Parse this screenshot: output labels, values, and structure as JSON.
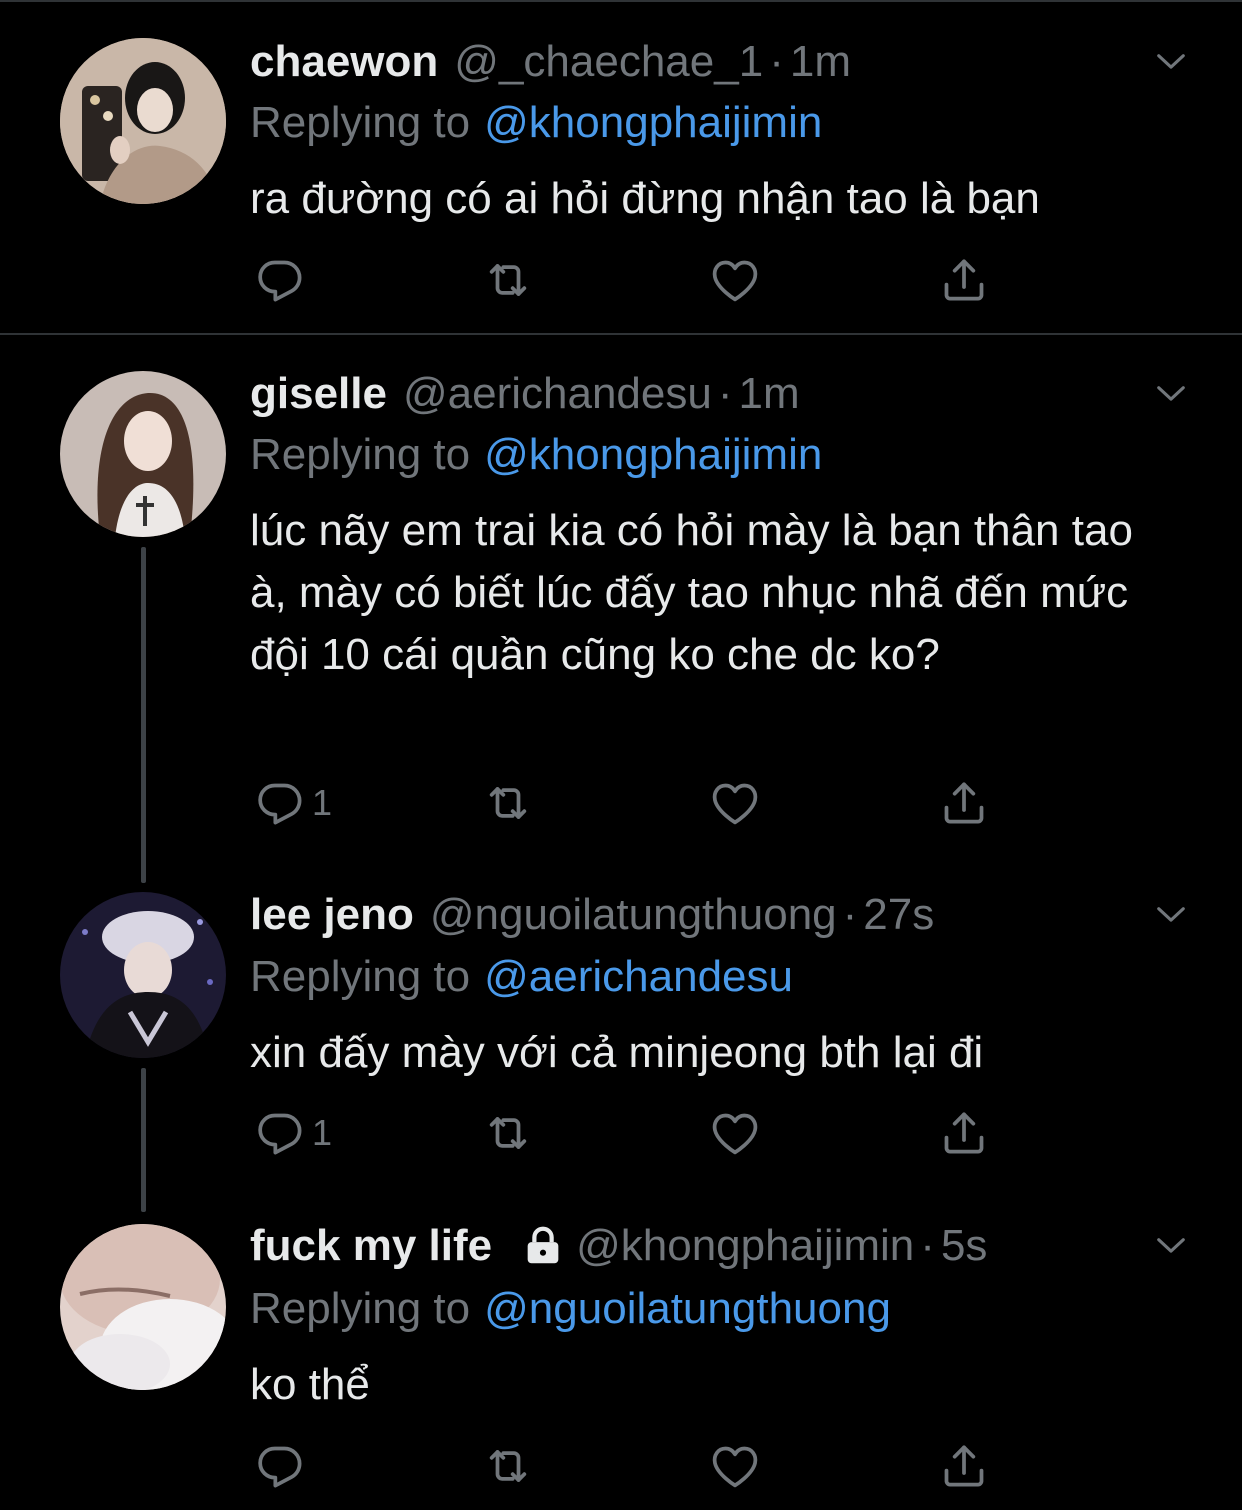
{
  "tweets": [
    {
      "name": "chaewon",
      "handle": "@_chaechae_1",
      "separator": "·",
      "time": "1m",
      "replying_prefix": "Replying to",
      "replying_to": "@khongphaijimin",
      "text": "ra đường có ai hỏi đừng nhận tao là bạn",
      "reply_count": ""
    },
    {
      "name": "giselle",
      "handle": "@aerichandesu",
      "separator": "·",
      "time": "1m",
      "replying_prefix": "Replying to",
      "replying_to": "@khongphaijimin",
      "text": "lúc nãy em trai kia có hỏi mày là bạn thân tao à, mày có biết lúc đấy tao nhục nhã đến mức đội 10 cái quần cũng ko che dc ko?",
      "reply_count": "1"
    },
    {
      "name": "lee jeno",
      "handle": "@nguoilatungthuong",
      "separator": "·",
      "time": "27s",
      "replying_prefix": "Replying to",
      "replying_to": "@aerichandesu",
      "text": "xin đấy mày với cả minjeong bth lại đi",
      "reply_count": "1"
    },
    {
      "name": "fuck my life",
      "handle": "@khongphaijimin",
      "separator": "·",
      "time": "5s",
      "replying_prefix": "Replying to",
      "replying_to": "@nguoilatungthuong",
      "text": "ko thể",
      "reply_count": "",
      "protected": true
    }
  ],
  "icons": {
    "reply": "reply-icon",
    "retweet": "retweet-icon",
    "like": "heart-icon",
    "share": "share-icon",
    "more": "chevron-down-icon",
    "protected": "lock-icon"
  },
  "colors": {
    "background": "#000000",
    "text": "#e7e9ea",
    "secondary": "#71767b",
    "link": "#4a99e9",
    "divider": "#2f3336"
  }
}
